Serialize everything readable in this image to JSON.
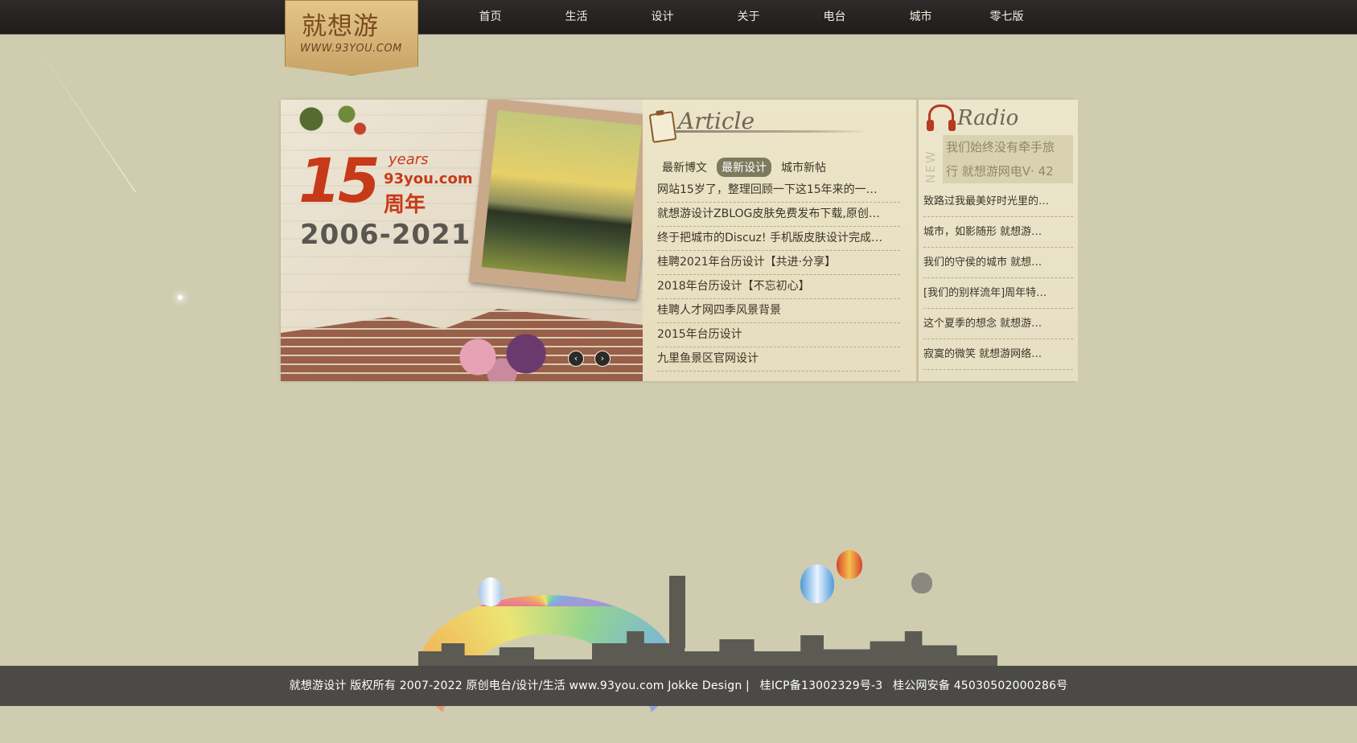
{
  "logo": {
    "mark": "就想游",
    "url": "WWW.93YOU.COM"
  },
  "nav": [
    "首页",
    "生活",
    "设计",
    "关于",
    "电台",
    "城市",
    "零七版"
  ],
  "banner": {
    "num": "15",
    "years": "years",
    "site": "93you.com",
    "zhou": "周年",
    "range": "2006-2021",
    "prev": "‹",
    "next": "›"
  },
  "article": {
    "title": "Article",
    "tabs": [
      "最新博文",
      "最新设计",
      "城市新帖"
    ],
    "active_tab": "最新设计",
    "items": [
      "网站15岁了，整理回顾一下这15年来的一…",
      "就想游设计ZBLOG皮肤免费发布下载,原创…",
      "终于把城市的Discuz! 手机版皮肤设计完成…",
      "桂聘2021年台历设计【共进·分享】",
      "2018年台历设计【不忘初心】",
      "桂聘人才网四季风景背景",
      "2015年台历设计",
      "九里鱼景区官网设计"
    ]
  },
  "radio": {
    "title": "Radio",
    "new_tag": "NEW",
    "ticker_1": "我们始终没有牵手旅",
    "ticker_2": "行 就想游网电V· 42",
    "items": [
      "致路过我最美好时光里的…",
      "城市，如影随形 就想游…",
      "我们的守侯的城市 就想…",
      "[我们的别样流年]周年特…",
      "这个夏季的想念 就想游…",
      "寂寞的微笑 就想游网络…"
    ]
  },
  "footer": {
    "left": "就想游设计 版权所有 2007-2022 原创电台/设计/生活 www.93you.com Jokke Design |",
    "icp": "桂ICP备13002329号-3",
    "police": "桂公网安备 45030502000286号"
  },
  "colors": {
    "bg": "#cfccb0",
    "topbar": "#2a2726",
    "accent": "#c73a19",
    "footer": "#4b4a47"
  }
}
